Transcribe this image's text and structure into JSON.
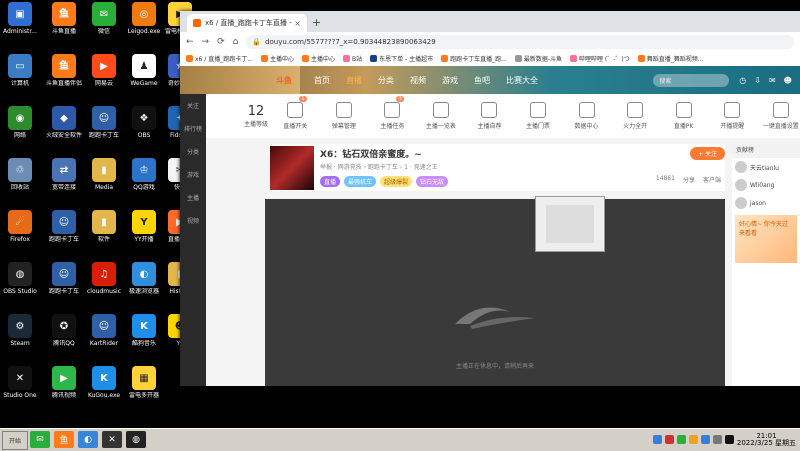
{
  "desktop": {
    "icons": [
      {
        "label": "Administr...",
        "color": "#2f6fd0",
        "glyph": "▣"
      },
      {
        "label": "斗鱼直播",
        "color": "#ff7a1a",
        "glyph": "鱼"
      },
      {
        "label": "微信",
        "color": "#2aae3a",
        "glyph": "✉"
      },
      {
        "label": "Leigod.exe",
        "color": "#f07a12",
        "glyph": "◎"
      },
      {
        "label": "雷电模拟器",
        "color": "#ffd23a",
        "glyph": "▶"
      },
      {
        "label": "计算机",
        "color": "#3c7cc4",
        "glyph": "▭"
      },
      {
        "label": "斗鱼直播伴侣",
        "color": "#ff7a1a",
        "glyph": "鱼"
      },
      {
        "label": "网易云",
        "color": "#ff4c1a",
        "glyph": "▶"
      },
      {
        "label": "WeGame",
        "color": "#ffffff",
        "glyph": "♟"
      },
      {
        "label": "奇妙加速",
        "color": "#3a5ec4",
        "glyph": "★"
      },
      {
        "label": "网络",
        "color": "#2d8a2d",
        "glyph": "◉"
      },
      {
        "label": "火绒安全软件",
        "color": "#2d59a8",
        "glyph": "◆"
      },
      {
        "label": "跑跑卡丁车",
        "color": "#2f5fa6",
        "glyph": "☺"
      },
      {
        "label": "OBS",
        "color": "#111111",
        "glyph": "❖"
      },
      {
        "label": "Fiddler",
        "color": "#1f66b4",
        "glyph": "✦"
      },
      {
        "label": "回收站",
        "color": "#6c8cb6",
        "glyph": "♲"
      },
      {
        "label": "宽带连接",
        "color": "#4a74b6",
        "glyph": "⇄"
      },
      {
        "label": "Media",
        "color": "#e2b64a",
        "glyph": "▮"
      },
      {
        "label": "QQ游戏",
        "color": "#2b74c8",
        "glyph": "♔"
      },
      {
        "label": "快手",
        "color": "#f5f5f5",
        "glyph": "✂"
      },
      {
        "label": "Firefox",
        "color": "#e66a17",
        "glyph": "☄"
      },
      {
        "label": "跑跑卡丁车",
        "color": "#2f5fa6",
        "glyph": "☺"
      },
      {
        "label": "软件",
        "color": "#e2b64a",
        "glyph": "▮"
      },
      {
        "label": "YY开播",
        "color": "#ffd500",
        "glyph": "Y"
      },
      {
        "label": "直播伴侣",
        "color": "#ff6a2a",
        "glyph": "▶"
      },
      {
        "label": "OBS Studio",
        "color": "#222222",
        "glyph": "◍"
      },
      {
        "label": "跑跑卡丁车",
        "color": "#2f5fa6",
        "glyph": "☺"
      },
      {
        "label": "cloudmusic",
        "color": "#d81e06",
        "glyph": "♫"
      },
      {
        "label": "极速浏览器",
        "color": "#2f8fde",
        "glyph": "◐"
      },
      {
        "label": "History",
        "color": "#e2b64a",
        "glyph": "▮"
      },
      {
        "label": "Steam",
        "color": "#1b2838",
        "glyph": "⚙"
      },
      {
        "label": "腾讯QQ",
        "color": "#111111",
        "glyph": "✪"
      },
      {
        "label": "KartRider",
        "color": "#2f5fa6",
        "glyph": "☺"
      },
      {
        "label": "酷狗音乐",
        "color": "#1f8ee8",
        "glyph": "K"
      },
      {
        "label": "YY",
        "color": "#ffd500",
        "glyph": "☻"
      },
      {
        "label": "Studio One",
        "color": "#111111",
        "glyph": "✕"
      },
      {
        "label": "腾讯视频",
        "color": "#2fb84a",
        "glyph": "▶"
      },
      {
        "label": "KuGou.exe",
        "color": "#1f8ee8",
        "glyph": "K"
      },
      {
        "label": "雷电多开器",
        "color": "#ffd23a",
        "glyph": "▦"
      }
    ]
  },
  "browser": {
    "tab_title": "x6 / 直播_跑跑卡丁车直播 - 斗鱼...",
    "tab_close": "×",
    "new_tab": "+",
    "nav": {
      "back": "←",
      "forward": "→",
      "reload": "⟳",
      "home": "⌂"
    },
    "address": "douyu.com/5577???7_x=0.90344823890063429",
    "bookmarks": [
      {
        "label": "x6 / 直播_跑跑卡丁...",
        "color": "#ff7a1a"
      },
      {
        "label": "主播中心",
        "color": "#ff7a1a"
      },
      {
        "label": "主播中心",
        "color": "#ff7a1a"
      },
      {
        "label": "B站",
        "color": "#fb7299"
      },
      {
        "label": "东恩下单 - 主播超市",
        "color": "#1a3e8c"
      },
      {
        "label": "跑跑卡丁车直播_跑...",
        "color": "#ff7a1a"
      },
      {
        "label": "最新数据-斗鱼",
        "color": "#999999"
      },
      {
        "label": "哔哩哔哩 (゜-゜)つ",
        "color": "#fb7299"
      },
      {
        "label": "舞蹈直播_舞蹈视频...",
        "color": "#ff7a1a"
      }
    ]
  },
  "site": {
    "logo": "斗鱼",
    "nav": [
      "首页",
      "直播",
      "分类",
      "视频",
      "游戏",
      "鱼吧",
      "比赛大全"
    ],
    "nav_active": 1,
    "search_placeholder": "搜索",
    "left_nav": [
      "关注",
      "排行榜",
      "分类",
      "游戏",
      "主播",
      "视频"
    ],
    "toolbar": {
      "count": "12",
      "count_label": "主播等级",
      "items": [
        {
          "label": "直播开关",
          "badge": "1"
        },
        {
          "label": "弹幕管理",
          "badge": ""
        },
        {
          "label": "主播任务",
          "badge": "3"
        },
        {
          "label": "主播一览表",
          "badge": ""
        },
        {
          "label": "主播自荐",
          "badge": ""
        },
        {
          "label": "主播门票",
          "badge": ""
        },
        {
          "label": "数据中心",
          "badge": ""
        },
        {
          "label": "火力全开",
          "badge": ""
        },
        {
          "label": "直播PK",
          "badge": ""
        },
        {
          "label": "开播提醒",
          "badge": ""
        },
        {
          "label": "一键直播设置",
          "badge": ""
        }
      ]
    },
    "room": {
      "title": "X6：钻石双倍亲蜜度。~",
      "meta": "举报 · 网游竞技 › 跑跑卡丁车 › 1 · 竞速之王",
      "tags": [
        {
          "text": "直播",
          "bg": "#a56cf0",
          "fg": "#ffffff"
        },
        {
          "text": "最强机车",
          "bg": "#6fc1ff",
          "fg": "#ffffff"
        },
        {
          "text": "超级爆裂",
          "bg": "#ffe17a",
          "fg": "#b25e00"
        },
        {
          "text": "钻石无敌",
          "bg": "#c88dff",
          "fg": "#ffffff"
        }
      ],
      "follow_label": "+ 关注",
      "follow_count": "14861",
      "share_label": "分享",
      "report_label": "客户端"
    },
    "player": {
      "status": "主播正在休息中，请稍后再来"
    },
    "right_panel": {
      "title": "贡献榜",
      "users": [
        "天云tianlu",
        "Wli0ang",
        "jason"
      ],
      "ad_text": "好心情~ 你今天过来看看"
    }
  },
  "taskbar": {
    "start_label": "开始",
    "apps": [
      {
        "color": "#2aae3a",
        "glyph": "✉"
      },
      {
        "color": "#ff7a1a",
        "glyph": "鱼"
      },
      {
        "color": "#3a86d6",
        "glyph": "◐"
      },
      {
        "color": "#333333",
        "glyph": "✕"
      },
      {
        "color": "#222222",
        "glyph": "◍"
      }
    ],
    "tray_icons": [
      "#3a7dd8",
      "#d03030",
      "#2aae3a",
      "#f0a020",
      "#3a7dd8",
      "#777777",
      "#111111"
    ],
    "time": "21:01",
    "date": "2022/3/25 星期五"
  }
}
